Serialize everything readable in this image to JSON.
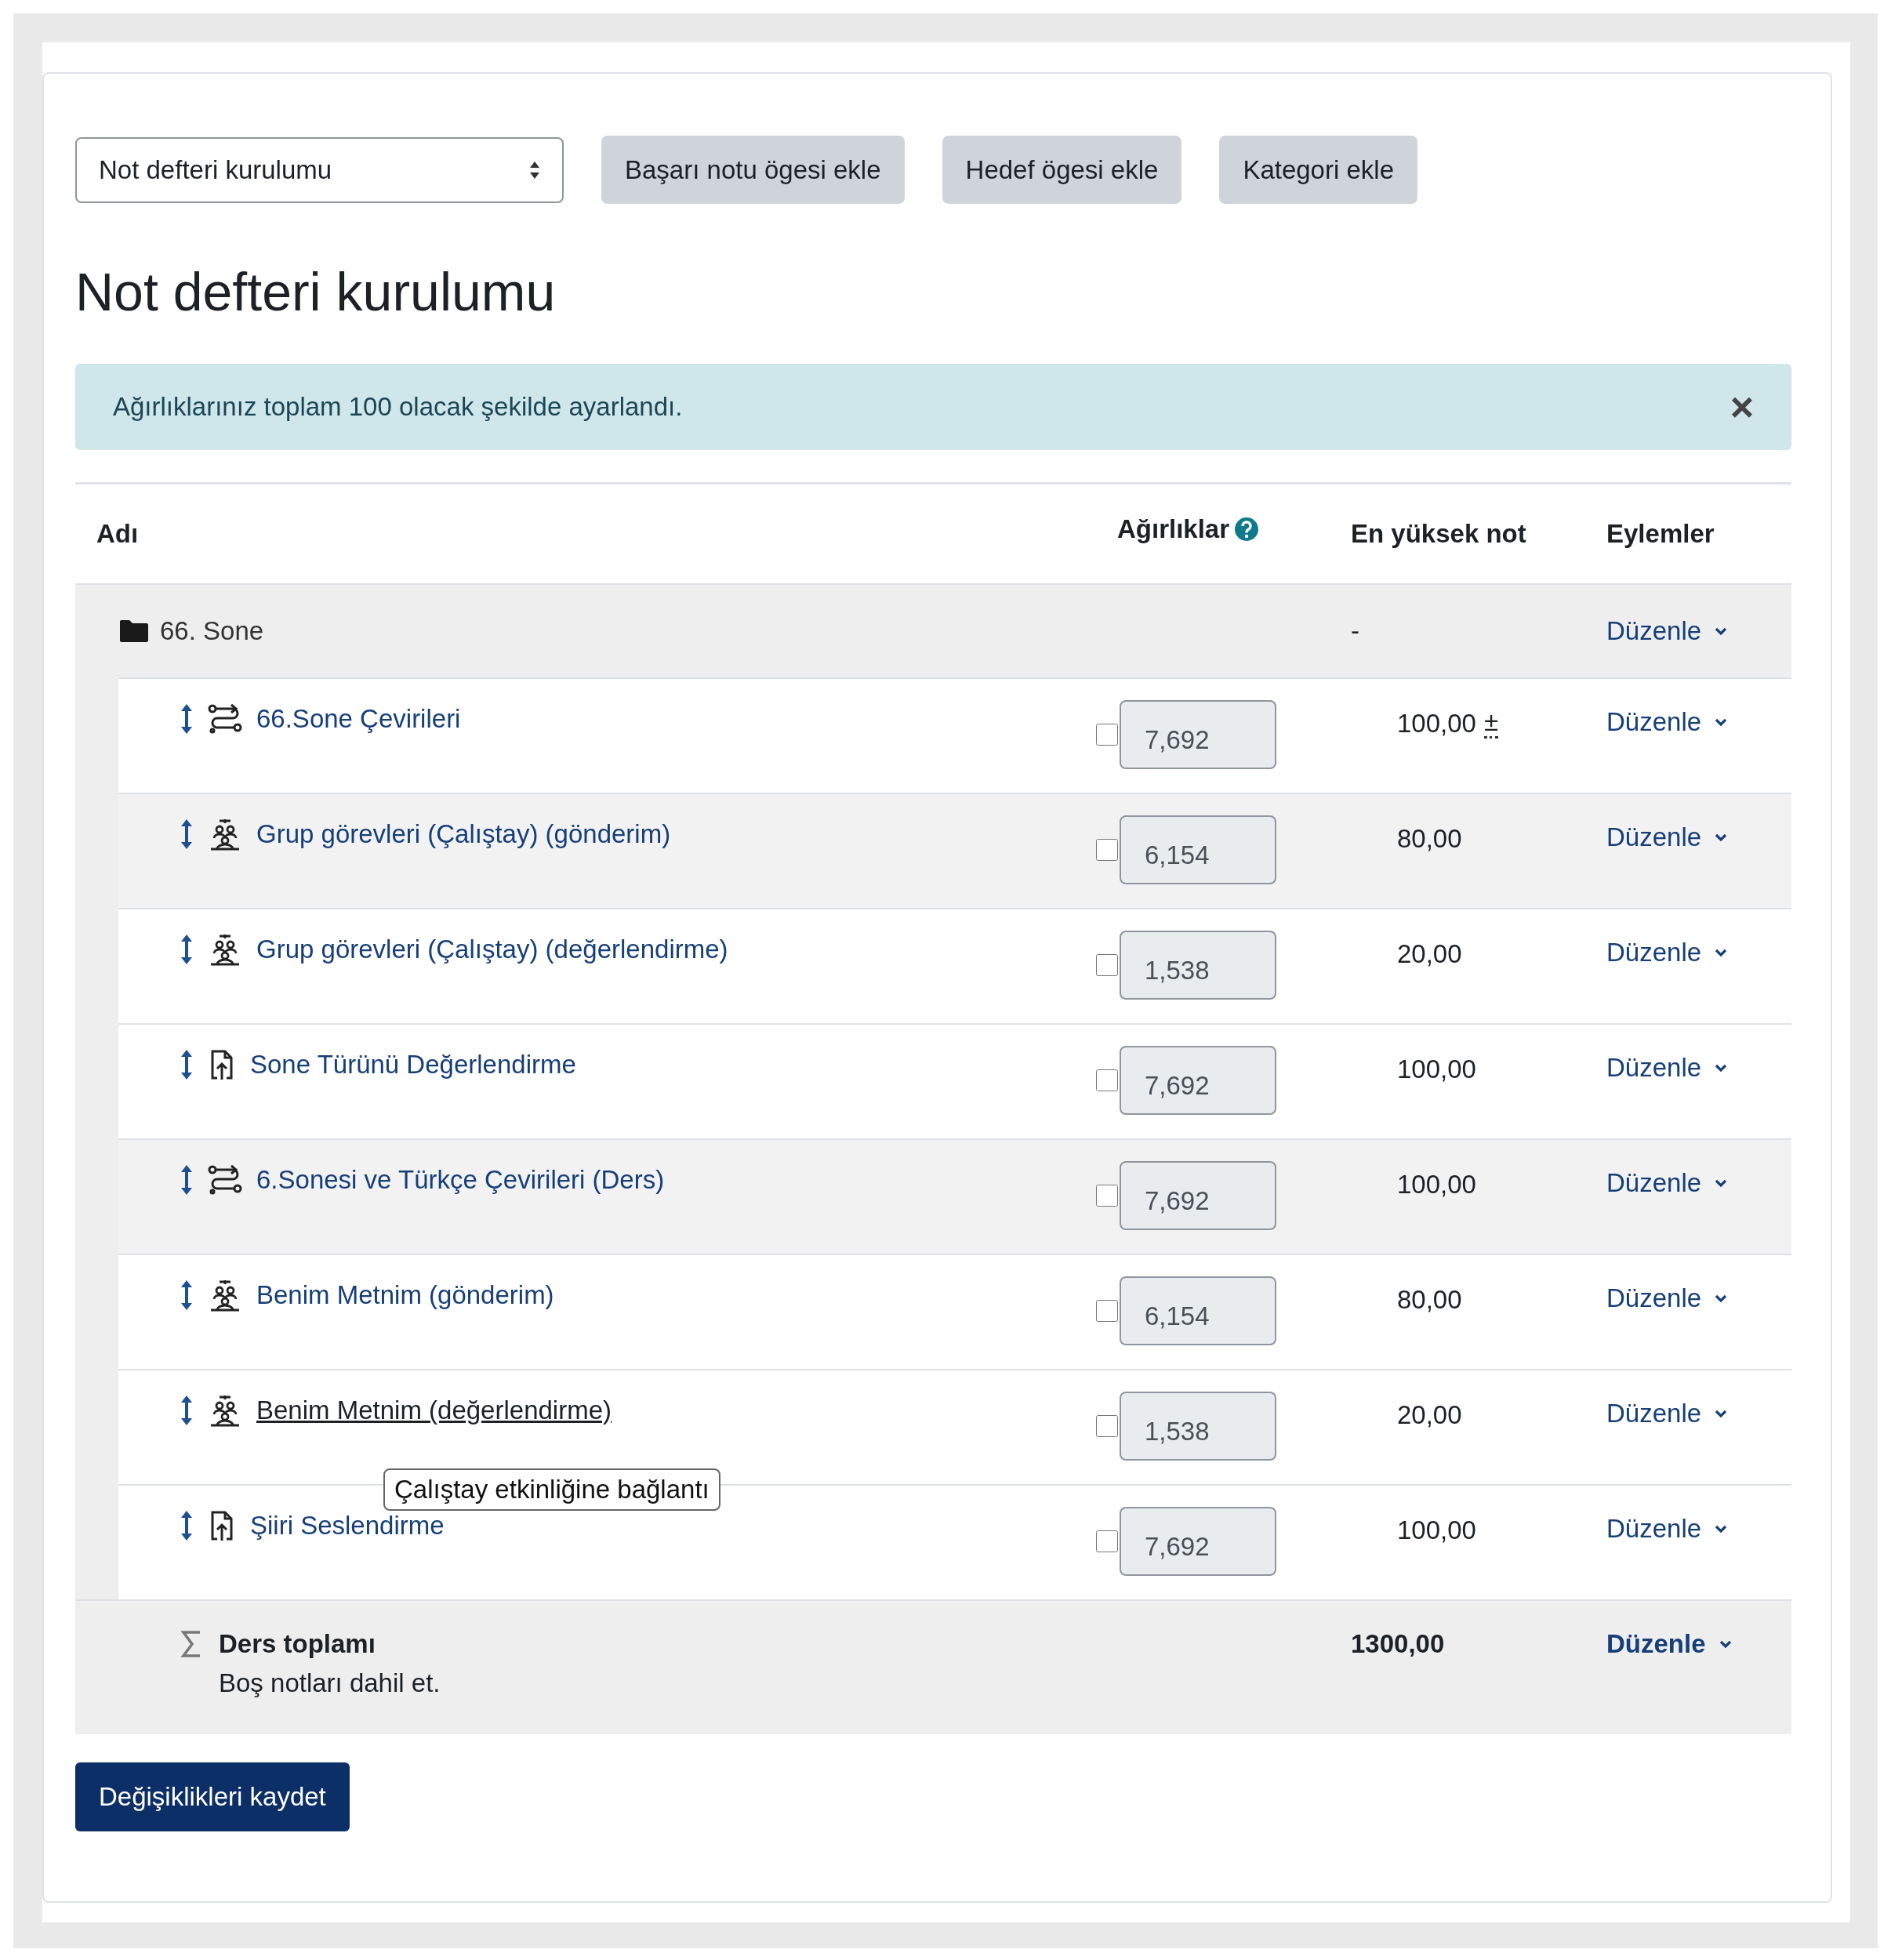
{
  "toolbar": {
    "select": {
      "value": "Not defteri kurulumu"
    },
    "buttons": [
      "Başarı notu ögesi ekle",
      "Hedef ögesi ekle",
      "Kategori ekle"
    ]
  },
  "page_title": "Not defteri kurulumu",
  "alert": {
    "message": "Ağırlıklarınız toplam 100 olacak şekilde ayarlandı.",
    "close": "×"
  },
  "table": {
    "columns": [
      "Adı",
      "Ağırlıklar",
      "En yüksek not",
      "Eylemler"
    ],
    "category": {
      "name": "66. Sone",
      "max_grade": "-",
      "action": "Düzenle"
    },
    "items": [
      {
        "kind": "lesson",
        "name": "66.Sone Çevirileri",
        "weight_checked": false,
        "weight": "7,692",
        "max_grade": "100,00",
        "grade_note": "±",
        "action": "Düzenle",
        "shaded": false,
        "hovered": false
      },
      {
        "kind": "workshop",
        "name": "Grup görevleri (Çalıştay) (gönderim)",
        "weight_checked": false,
        "weight": "6,154",
        "max_grade": "80,00",
        "action": "Düzenle",
        "shaded": true,
        "hovered": false
      },
      {
        "kind": "workshop",
        "name": "Grup görevleri (Çalıştay) (değerlendirme)",
        "weight_checked": false,
        "weight": "1,538",
        "max_grade": "20,00",
        "action": "Düzenle",
        "shaded": false,
        "hovered": false
      },
      {
        "kind": "assignment",
        "name": "Sone Türünü Değerlendirme",
        "weight_checked": false,
        "weight": "7,692",
        "max_grade": "100,00",
        "action": "Düzenle",
        "shaded": false,
        "hovered": false
      },
      {
        "kind": "lesson",
        "name": "6.Sonesi ve Türkçe Çevirileri (Ders)",
        "weight_checked": false,
        "weight": "7,692",
        "max_grade": "100,00",
        "action": "Düzenle",
        "shaded": true,
        "hovered": false
      },
      {
        "kind": "workshop",
        "name": "Benim Metnim (gönderim)",
        "weight_checked": false,
        "weight": "6,154",
        "max_grade": "80,00",
        "action": "Düzenle",
        "shaded": false,
        "hovered": false
      },
      {
        "kind": "workshop",
        "name": "Benim Metnim (değerlendirme)",
        "weight_checked": false,
        "weight": "1,538",
        "max_grade": "20,00",
        "action": "Düzenle",
        "shaded": false,
        "hovered": true,
        "tooltip": "Çalıştay etkinliğine bağlantı"
      },
      {
        "kind": "assignment",
        "name": "Şiiri Seslendirme",
        "weight_checked": false,
        "weight": "7,692",
        "max_grade": "100,00",
        "action": "Düzenle",
        "shaded": false,
        "hovered": false
      }
    ],
    "total": {
      "name": "Ders toplamı",
      "note": "Boş notları dahil et.",
      "max_grade": "1300,00",
      "action": "Düzenle"
    }
  },
  "save_button": "Değişiklikleri kaydet"
}
